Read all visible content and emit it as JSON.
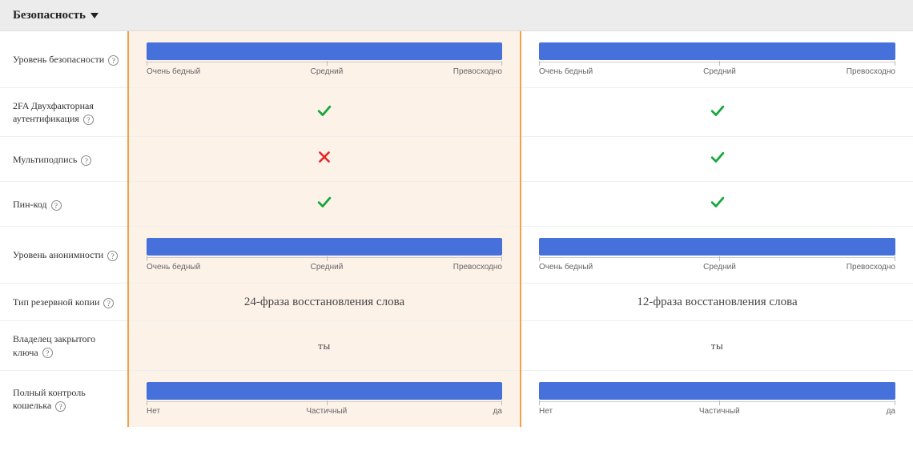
{
  "section": {
    "title": "Безопасность"
  },
  "rows": [
    {
      "label": "Уровень безопасности",
      "help": true,
      "type": "bar",
      "scale": [
        "Очень бедный",
        "Средний",
        "Превосходно"
      ],
      "colA": 100,
      "colB": 100
    },
    {
      "label": "2FA Двухфакторная аутентификация",
      "help": true,
      "type": "bool",
      "colA": true,
      "colB": true
    },
    {
      "label": "Мультиподпись",
      "help": true,
      "type": "bool",
      "colA": false,
      "colB": true
    },
    {
      "label": "Пин-код",
      "help": true,
      "type": "bool",
      "colA": true,
      "colB": true
    },
    {
      "label": "Уровень анонимности",
      "help": true,
      "type": "bar",
      "scale": [
        "Очень бедный",
        "Средний",
        "Превосходно"
      ],
      "colA": 100,
      "colB": 100
    },
    {
      "label": "Тип резервной копии",
      "help": true,
      "type": "text",
      "colA": "24-фраза восстановления слова",
      "colB": "12-фраза восстановления слова"
    },
    {
      "label": "Владелец закрытого ключа",
      "help": true,
      "type": "text_caps",
      "colA": "ты",
      "colB": "ты"
    },
    {
      "label": "Полный контроль кошелька",
      "help": true,
      "type": "bar",
      "scale": [
        "Нет",
        "Частичный",
        "да"
      ],
      "colA": 100,
      "colB": 100
    }
  ]
}
